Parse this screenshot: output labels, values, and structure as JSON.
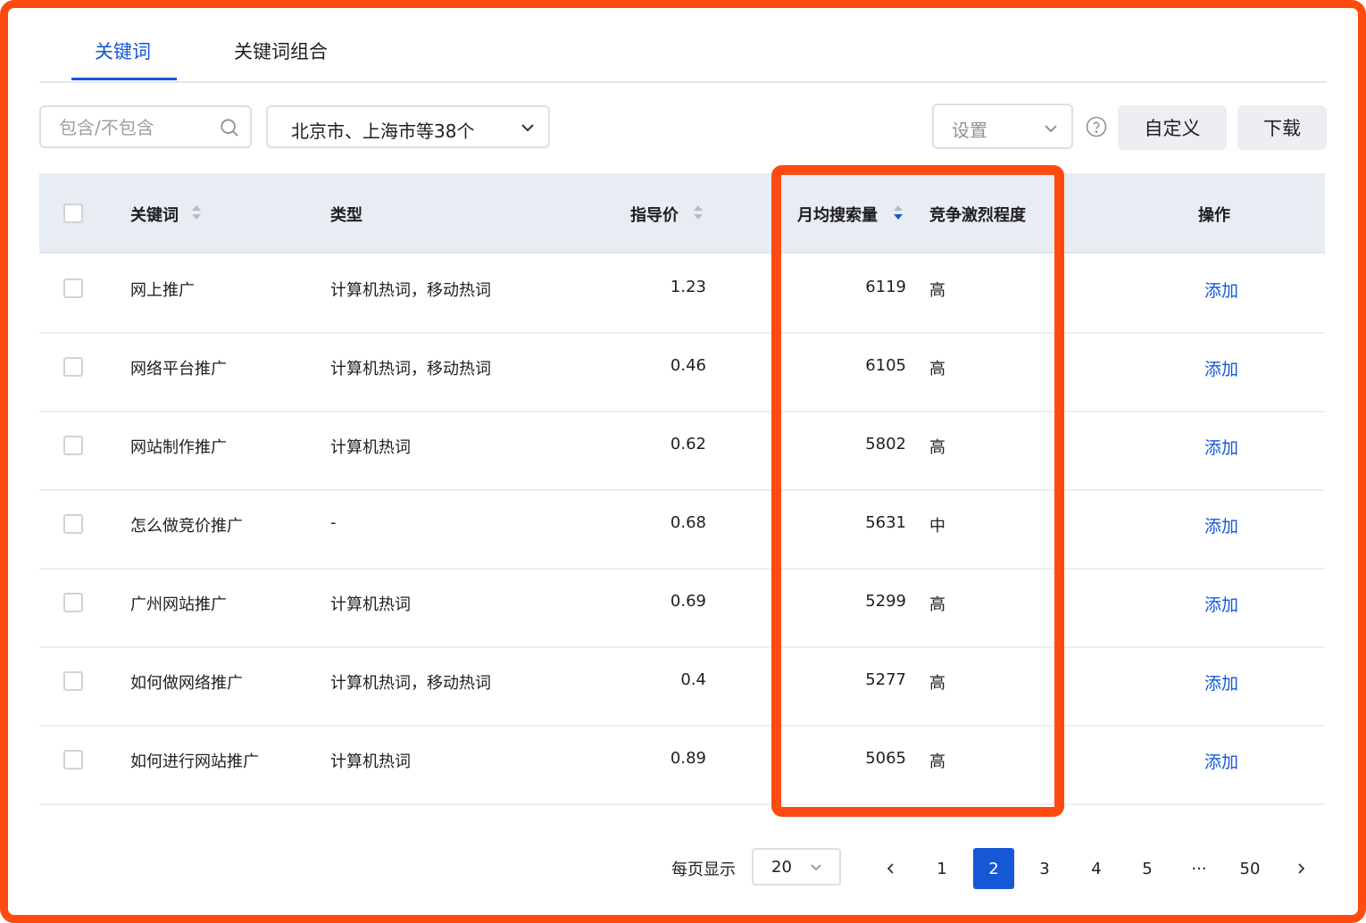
{
  "tabs": [
    {
      "label": "关键词",
      "active": true
    },
    {
      "label": "关键词组合",
      "active": false
    }
  ],
  "toolbar": {
    "search_placeholder": "包含/不包含",
    "region_label": "北京市、上海市等38个",
    "settings_label": "设置",
    "custom_label": "自定义",
    "download_label": "下载"
  },
  "table": {
    "headers": {
      "keyword": "关键词",
      "type": "类型",
      "price": "指导价",
      "volume": "月均搜索量",
      "competition": "竞争激烈程度",
      "action": "操作"
    },
    "rows": [
      {
        "keyword": "网上推广",
        "type": "计算机热词，移动热词",
        "price": "1.23",
        "volume": "6119",
        "competition": "高",
        "action": "添加"
      },
      {
        "keyword": "网络平台推广",
        "type": "计算机热词，移动热词",
        "price": "0.46",
        "volume": "6105",
        "competition": "高",
        "action": "添加"
      },
      {
        "keyword": "网站制作推广",
        "type": "计算机热词",
        "price": "0.62",
        "volume": "5802",
        "competition": "高",
        "action": "添加"
      },
      {
        "keyword": "怎么做竞价推广",
        "type": "-",
        "price": "0.68",
        "volume": "5631",
        "competition": "中",
        "action": "添加"
      },
      {
        "keyword": "广州网站推广",
        "type": "计算机热词",
        "price": "0.69",
        "volume": "5299",
        "competition": "高",
        "action": "添加"
      },
      {
        "keyword": "如何做网络推广",
        "type": "计算机热词，移动热词",
        "price": "0.4",
        "volume": "5277",
        "competition": "高",
        "action": "添加"
      },
      {
        "keyword": "如何进行网站推广",
        "type": "计算机热词",
        "price": "0.89",
        "volume": "5065",
        "competition": "高",
        "action": "添加"
      }
    ]
  },
  "pagination": {
    "per_page_label": "每页显示",
    "page_size": "20",
    "pages": [
      "1",
      "2",
      "3",
      "4",
      "5",
      "···",
      "50"
    ],
    "current": "2"
  },
  "colors": {
    "accent": "#1558d6",
    "highlight": "#ff4a10",
    "header_bg": "#e8ecf3"
  }
}
